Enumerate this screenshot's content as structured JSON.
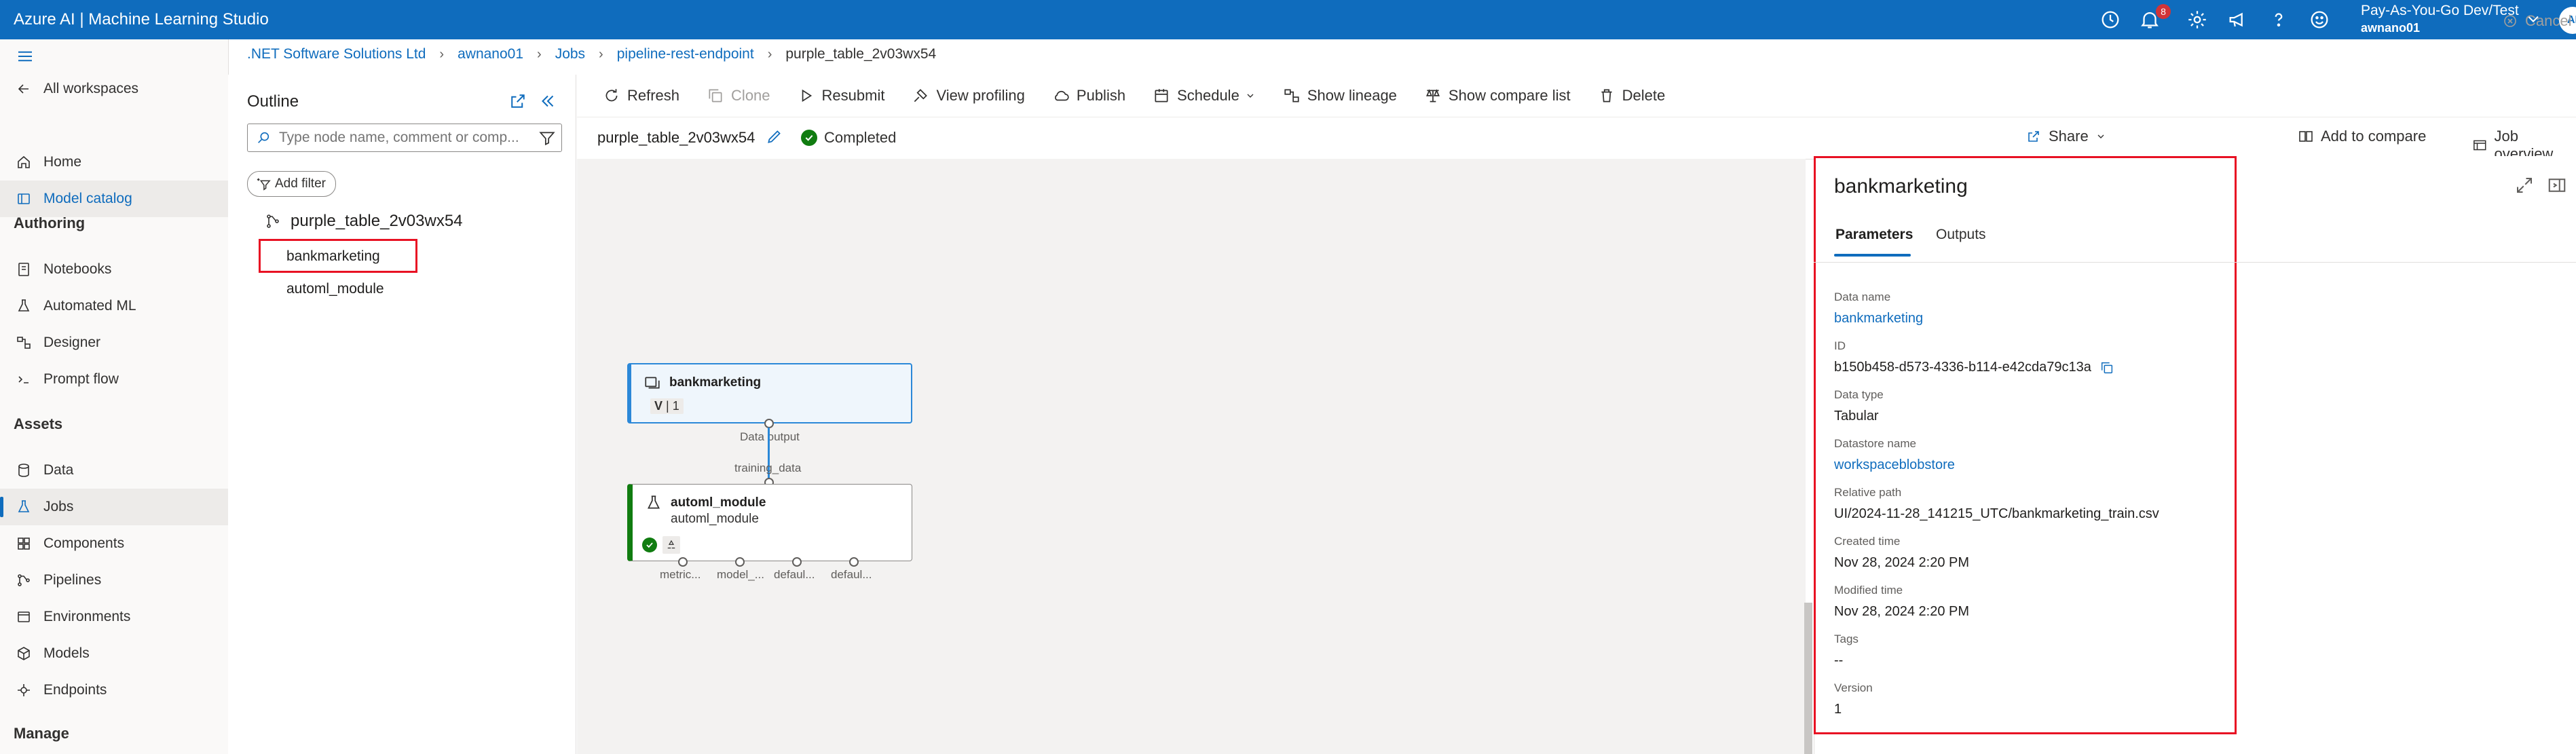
{
  "header": {
    "title": "Azure AI | Machine Learning Studio",
    "notification_count": "8",
    "account_line1": "Pay-As-You-Go Dev/Test",
    "account_line2": "awnano01",
    "avatar": "AI"
  },
  "nav": {
    "all_workspaces": "All workspaces",
    "home": "Home",
    "model_catalog": "Model catalog",
    "section_authoring": "Authoring",
    "notebooks": "Notebooks",
    "automated_ml": "Automated ML",
    "designer": "Designer",
    "prompt_flow": "Prompt flow",
    "section_assets": "Assets",
    "data": "Data",
    "jobs": "Jobs",
    "components": "Components",
    "pipelines": "Pipelines",
    "environments": "Environments",
    "models": "Models",
    "endpoints": "Endpoints",
    "section_manage": "Manage"
  },
  "breadcrumb": [
    ".NET Software Solutions Ltd",
    "awnano01",
    "Jobs",
    "pipeline-rest-endpoint",
    "purple_table_2v03wx54"
  ],
  "outline": {
    "title": "Outline",
    "search_placeholder": "Type node name, comment or comp...",
    "add_filter": "Add filter",
    "root": "purple_table_2v03wx54",
    "items": [
      "bankmarketing",
      "automl_module"
    ]
  },
  "toolbar": {
    "refresh": "Refresh",
    "clone": "Clone",
    "resubmit": "Resubmit",
    "view_profiling": "View profiling",
    "publish": "Publish",
    "schedule": "Schedule",
    "show_lineage": "Show lineage",
    "show_compare_list": "Show compare list",
    "delete": "Delete",
    "cancel": "Cancel"
  },
  "job": {
    "name": "purple_table_2v03wx54",
    "status": "Completed",
    "share": "Share",
    "add_to_compare": "Add to compare",
    "job_overview": "Job overview"
  },
  "canvas": {
    "data_node": {
      "title": "bankmarketing",
      "version_label": "V",
      "version": "1"
    },
    "data_output": "Data output",
    "training_data": "training_data",
    "module_node": {
      "title": "automl_module",
      "subtitle": "automl_module"
    },
    "outputs": [
      "metric...",
      "model_...",
      "defaul...",
      "defaul..."
    ]
  },
  "panel": {
    "title": "bankmarketing",
    "tabs": [
      "Parameters",
      "Outputs"
    ],
    "fields": [
      {
        "label": "Data name",
        "value": "bankmarketing",
        "link": true
      },
      {
        "label": "ID",
        "value": "b150b458-d573-4336-b114-e42cda79c13a",
        "link": false
      },
      {
        "label": "Data type",
        "value": "Tabular",
        "link": false
      },
      {
        "label": "Datastore name",
        "value": "workspaceblobstore",
        "link": true
      },
      {
        "label": "Relative path",
        "value": "UI/2024-11-28_141215_UTC/bankmarketing_train.csv",
        "link": false
      },
      {
        "label": "Created time",
        "value": "Nov 28, 2024 2:20 PM",
        "link": false
      },
      {
        "label": "Modified time",
        "value": "Nov 28, 2024 2:20 PM",
        "link": false
      },
      {
        "label": "Tags",
        "value": "--",
        "link": false
      },
      {
        "label": "Version",
        "value": "1",
        "link": false
      }
    ]
  },
  "colors": {
    "accent": "#0f6cbd",
    "success": "#107c10",
    "highlight": "#e81123"
  }
}
